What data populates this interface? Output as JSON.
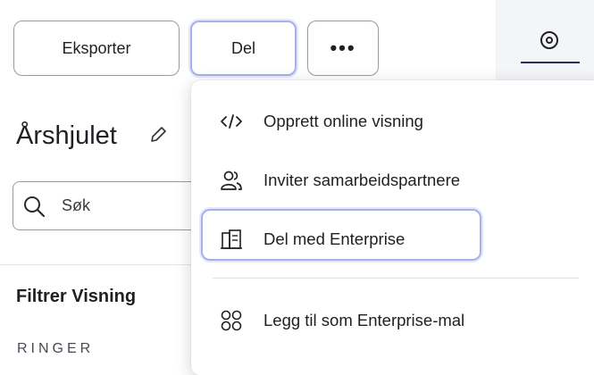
{
  "toolbar": {
    "export_label": "Eksporter",
    "share_label": "Del",
    "more_label": "•••"
  },
  "sidebar": {
    "title": "Årshjulet",
    "search_placeholder": "Søk",
    "filter_heading": "Filtrer Visning",
    "section_label": "RINGER"
  },
  "share_menu": {
    "items": [
      {
        "icon": "code-icon",
        "label": "Opprett online visning"
      },
      {
        "icon": "users-icon",
        "label": "Inviter samarbeidspartnere"
      },
      {
        "icon": "building-icon",
        "label": "Del med Enterprise"
      },
      {
        "icon": "template-icon",
        "label": "Legg til som Enterprise-mal"
      }
    ]
  },
  "right_panel": {
    "tab_icon": "target-icon"
  },
  "colors": {
    "focus_ring": "#a8b0ec",
    "tab_underline": "#2b2d5c",
    "panel_bg": "#f4f5f8"
  }
}
